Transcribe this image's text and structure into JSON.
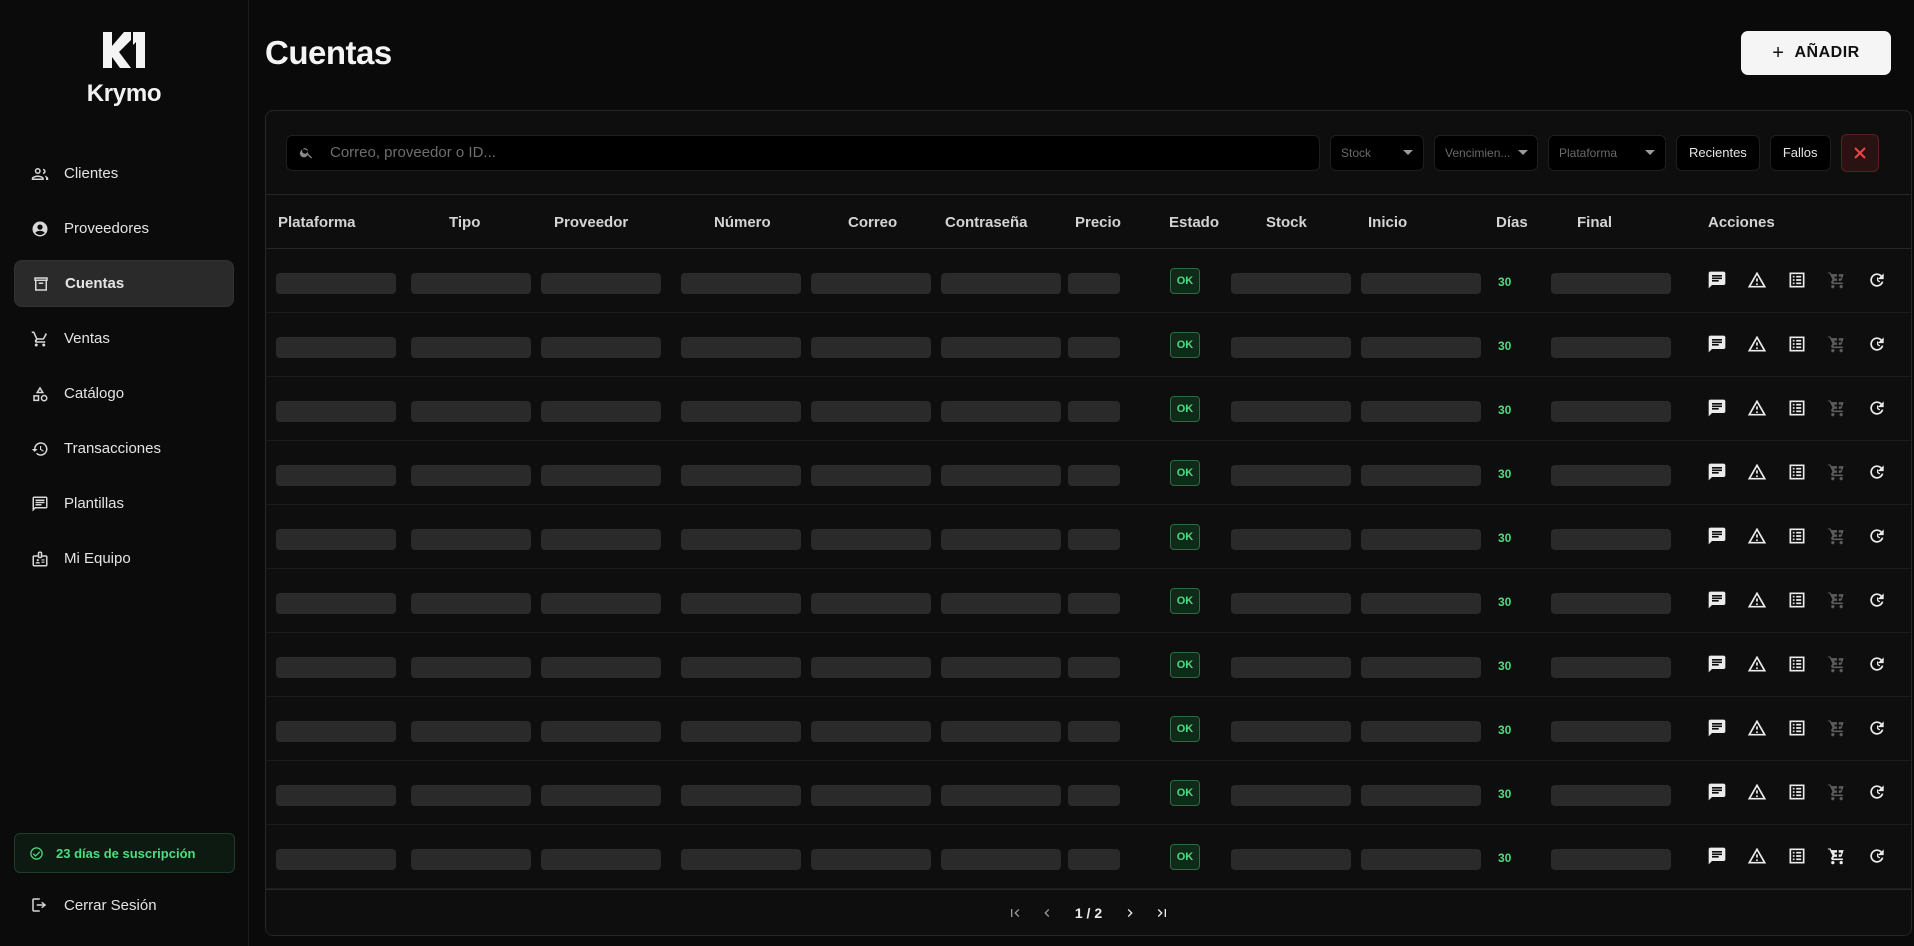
{
  "brand": {
    "name": "Krymo"
  },
  "sidebar": {
    "items": [
      {
        "label": "Clientes",
        "icon": "users-icon"
      },
      {
        "label": "Proveedores",
        "icon": "account-circle-icon"
      },
      {
        "label": "Cuentas",
        "icon": "archive-box-icon",
        "active": true
      },
      {
        "label": "Ventas",
        "icon": "cart-icon"
      },
      {
        "label": "Catálogo",
        "icon": "shapes-icon"
      },
      {
        "label": "Transacciones",
        "icon": "history-icon"
      },
      {
        "label": "Plantillas",
        "icon": "chat-icon"
      },
      {
        "label": "Mi Equipo",
        "icon": "badge-icon"
      }
    ],
    "subscription": "23 días de suscripción",
    "logout": "Cerrar Sesión"
  },
  "header": {
    "title": "Cuentas",
    "add_label": "AÑADIR"
  },
  "filters": {
    "search_placeholder": "Correo, proveedor o ID...",
    "stock": "Stock",
    "vencimiento": "Vencimien...",
    "plataforma": "Plataforma",
    "recientes": "Recientes",
    "fallos": "Fallos"
  },
  "table": {
    "columns": [
      "Plataforma",
      "Tipo",
      "Proveedor",
      "Número",
      "Correo",
      "Contraseña",
      "Precio",
      "Estado",
      "Stock",
      "Inicio",
      "Días",
      "Final",
      "Acciones"
    ],
    "rows": [
      {
        "estado": "OK",
        "dias": "30",
        "cart_enabled": false
      },
      {
        "estado": "OK",
        "dias": "30",
        "cart_enabled": false
      },
      {
        "estado": "OK",
        "dias": "30",
        "cart_enabled": false
      },
      {
        "estado": "OK",
        "dias": "30",
        "cart_enabled": false
      },
      {
        "estado": "OK",
        "dias": "30",
        "cart_enabled": false
      },
      {
        "estado": "OK",
        "dias": "30",
        "cart_enabled": false
      },
      {
        "estado": "OK",
        "dias": "30",
        "cart_enabled": false
      },
      {
        "estado": "OK",
        "dias": "30",
        "cart_enabled": false
      },
      {
        "estado": "OK",
        "dias": "30",
        "cart_enabled": false
      },
      {
        "estado": "OK",
        "dias": "30",
        "cart_enabled": true
      }
    ]
  },
  "pagination": {
    "label": "1 / 2"
  },
  "colors": {
    "accent": "#4ade80",
    "danger": "#ef4444",
    "background": "#0a0a0a"
  }
}
